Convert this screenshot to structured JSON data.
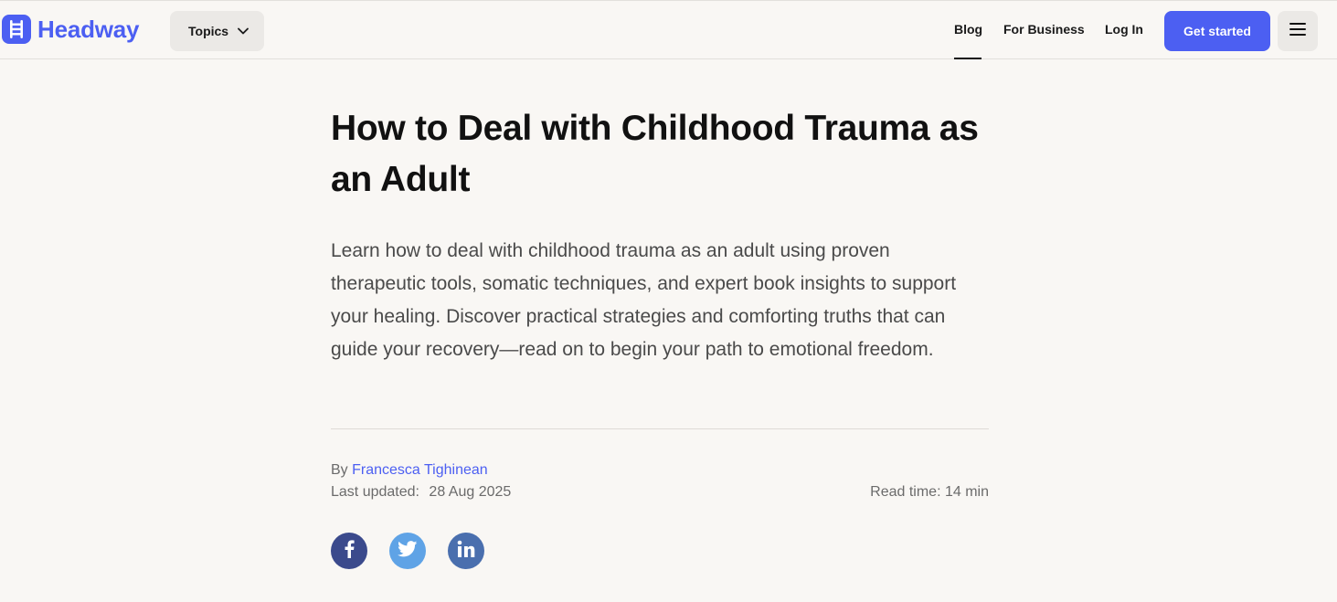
{
  "header": {
    "logo_text": "Headway",
    "topics_label": "Topics",
    "nav": {
      "blog": "Blog",
      "for_business": "For Business",
      "log_in": "Log In"
    },
    "cta_label": "Get started",
    "active_nav": "Blog"
  },
  "article": {
    "title": "How to Deal with Childhood Trauma as an Adult",
    "lead": "Learn how to deal with childhood trauma as an adult using proven therapeutic tools, somatic techniques, and expert book insights to support your healing. Discover practical strategies and comforting truths that can guide your recovery—read on to begin your path to emotional freedom.",
    "by_label": "By",
    "author": "Francesca Tighinean",
    "updated_label": "Last updated:",
    "updated_date": "28 Aug 2025",
    "read_time": "Read time: 14 min"
  },
  "share": {
    "facebook_icon": "facebook-icon",
    "twitter_icon": "twitter-icon",
    "linkedin_icon": "linkedin-icon"
  },
  "colors": {
    "brand": "#4c5ff2",
    "background": "#f9f7f4",
    "facebook": "#3b4a8c",
    "twitter": "#5fa3e6",
    "linkedin": "#4a6fae"
  }
}
